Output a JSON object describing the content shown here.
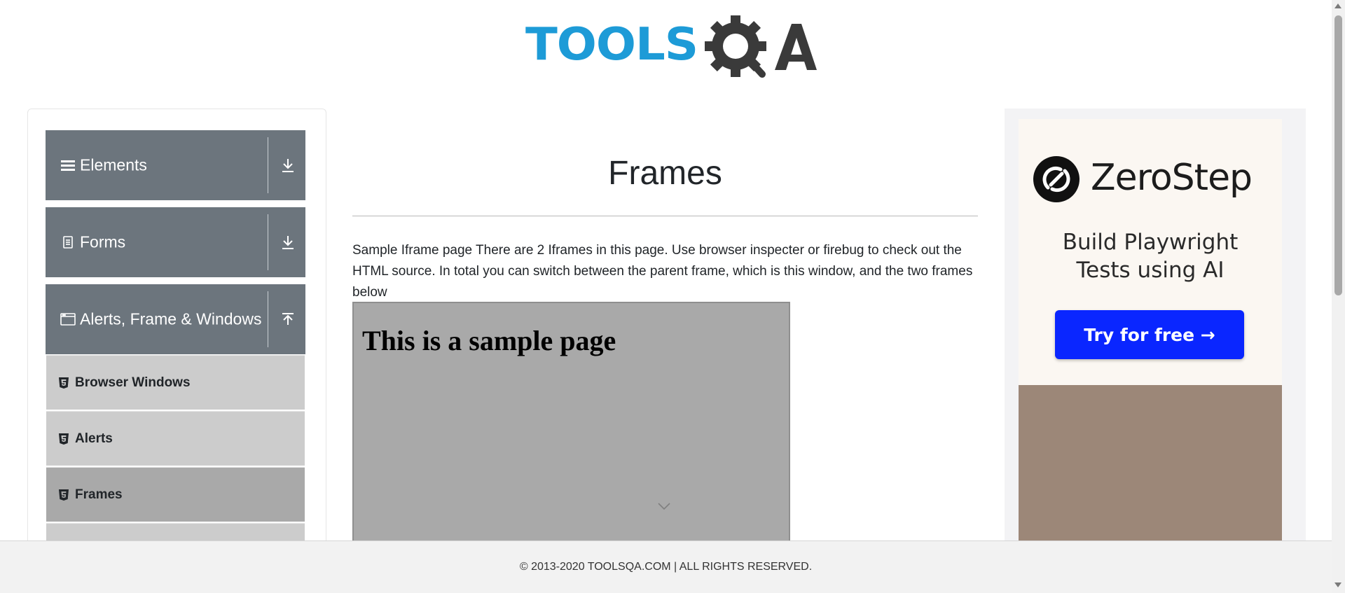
{
  "header": {
    "logo_text_left": "TOOLS",
    "logo_text_right": "QA"
  },
  "sidebar": {
    "groups": [
      {
        "label": "Elements",
        "icon": "hamburger-icon",
        "state": "collapsed"
      },
      {
        "label": "Forms",
        "icon": "document-icon",
        "state": "collapsed"
      },
      {
        "label": "Alerts, Frame & Windows",
        "icon": "window-icon",
        "state": "expanded"
      }
    ],
    "items": [
      {
        "label": "Browser Windows",
        "icon": "html5-icon",
        "active": false
      },
      {
        "label": "Alerts",
        "icon": "html5-icon",
        "active": false
      },
      {
        "label": "Frames",
        "icon": "html5-icon",
        "active": true
      }
    ]
  },
  "main": {
    "title": "Frames",
    "description": "Sample Iframe page There are 2 Iframes in this page. Use browser inspecter or firebug to check out the HTML source. In total you can switch between the parent frame, which is this window, and the two frames below",
    "iframe": {
      "heading": "This is a sample page"
    }
  },
  "ad": {
    "brand": "ZeroStep",
    "tagline_line1": "Build Playwright",
    "tagline_line2": "Tests using AI",
    "cta": "Try for free →"
  },
  "footer": {
    "copyright": "© 2013-2020 TOOLSQA.COM | ALL RIGHTS RESERVED."
  },
  "colors": {
    "logo_blue": "#1d9bd7",
    "logo_dark": "#3a3a3a",
    "group_header_bg": "#6c757d",
    "menu_item_bg": "#cccccc",
    "menu_item_active_bg": "#a9a9a9",
    "cta_blue": "#0a26ff"
  }
}
